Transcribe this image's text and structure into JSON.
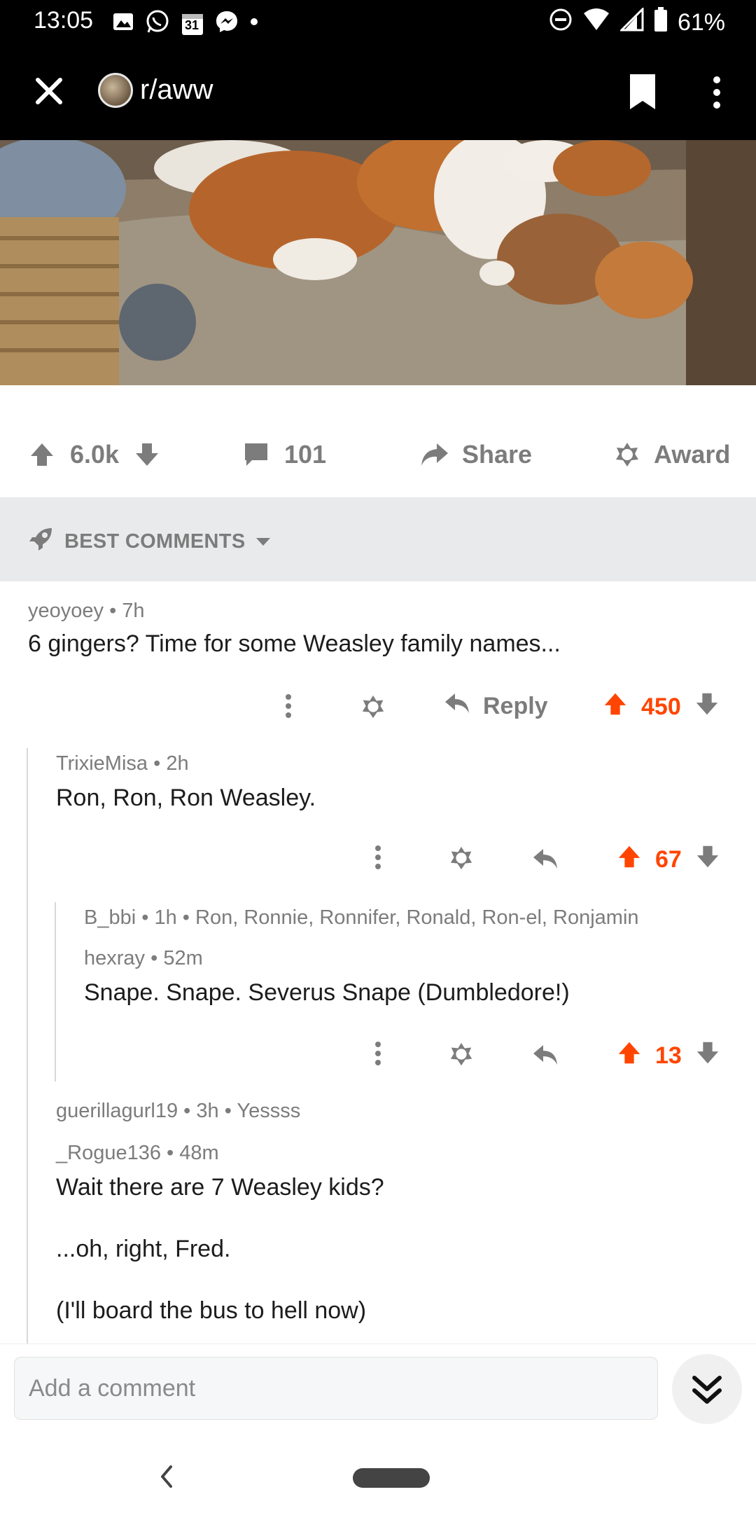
{
  "status_bar": {
    "time": "13:05",
    "battery": "61%",
    "notification_icons": [
      "image-icon",
      "whatsapp-icon",
      "calendar-icon",
      "messenger-icon",
      "dot-icon"
    ],
    "calendar_day": "31"
  },
  "header": {
    "subreddit": "r/aww"
  },
  "post_actions": {
    "score": "6.0k",
    "comments": "101",
    "share_label": "Share",
    "award_label": "Award"
  },
  "sort": {
    "label": "BEST COMMENTS"
  },
  "comments": [
    {
      "author": "yeoyoey",
      "age": "7h",
      "text": "6 gingers? Time for some Weasley family names...",
      "reply_label": "Reply",
      "score": "450"
    },
    {
      "author": "TrixieMisa",
      "age": "2h",
      "text": "Ron, Ron, Ron Weasley.",
      "score": "67"
    },
    {
      "author": "B_bbi",
      "age": "1h",
      "collapsed_preview": "Ron, Ronnie, Ronnifer, Ronald, Ron-el, Ronjamin"
    },
    {
      "author": "hexray",
      "age": "52m",
      "text": "Snape. Snape. Severus Snape (Dumbledore!)",
      "score": "13"
    },
    {
      "author": "guerillagurl19",
      "age": "3h",
      "collapsed_preview": "Yessss"
    },
    {
      "author": "_Rogue136",
      "age": "48m",
      "text_lines": [
        "Wait there are 7 Weasley kids?",
        "...oh, right, Fred.",
        "(I'll board the bus to hell now)"
      ]
    }
  ],
  "composer": {
    "placeholder": "Add a comment"
  },
  "colors": {
    "upvote": "#ff4500",
    "meta_gray": "#7c7c7c",
    "sort_bg": "#e9eaec"
  }
}
